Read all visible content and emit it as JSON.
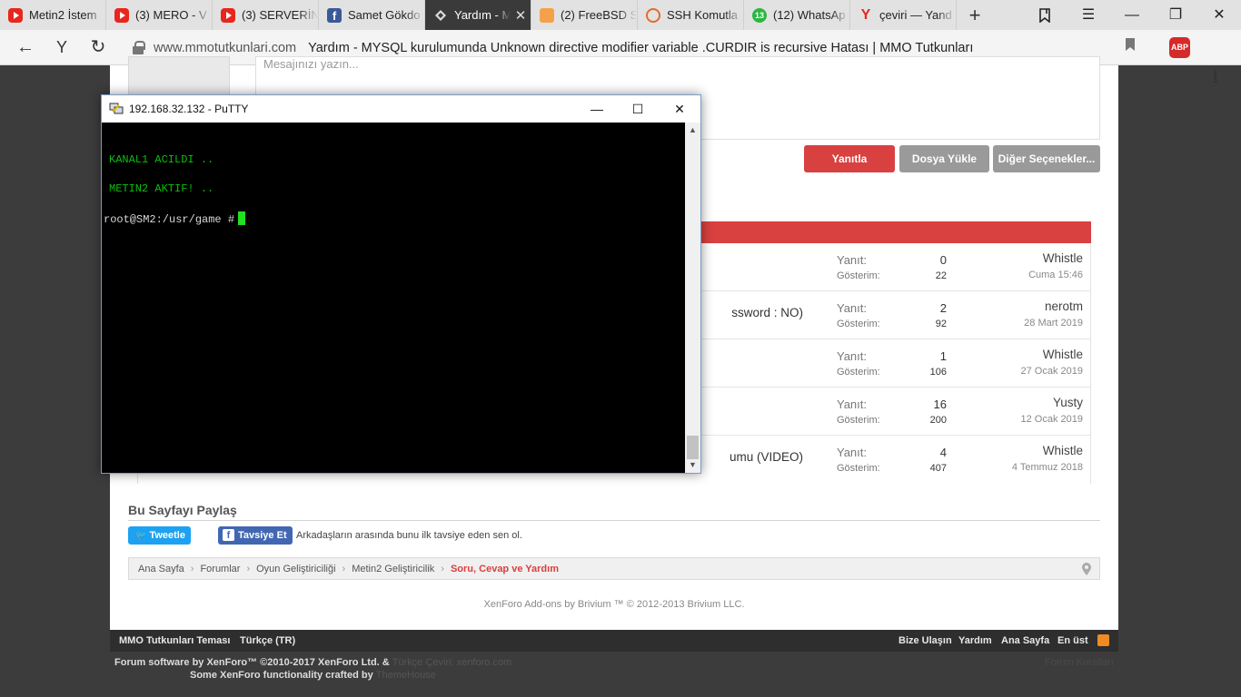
{
  "tabs": [
    {
      "label": "Metin2 İstem",
      "icon": "youtube-icon"
    },
    {
      "label": "(3) MERO - V",
      "icon": "youtube-icon"
    },
    {
      "label": "(3) SERVERİN",
      "icon": "youtube-icon"
    },
    {
      "label": "Samet Gökdo",
      "icon": "facebook-icon"
    },
    {
      "label": "Yardım - M",
      "icon": "xenforo-icon",
      "active": true
    },
    {
      "label": "(2) FreeBSD S",
      "icon": "freebsd-icon"
    },
    {
      "label": "SSH Komutla",
      "icon": "ssh-icon"
    },
    {
      "label": "(12) WhatsAp",
      "icon": "whatsapp-icon",
      "badge": "13"
    },
    {
      "label": "çeviri — Yand",
      "icon": "yandex-icon"
    }
  ],
  "address": {
    "domain": "www.mmotutkunlari.com",
    "title": "Yardım - MYSQL kurulumunda Unknown directive modifier variable .CURDIR is recursive Hatası | MMO Tutkunları"
  },
  "abp_label": "ABP",
  "editor": {
    "placeholder": "Mesajınızı yazın..."
  },
  "buttons": {
    "reply": "Yanıtla",
    "upload": "Dosya Yükle",
    "more": "Diğer Seçenekler..."
  },
  "threads": [
    {
      "title": "",
      "replies_label": "Yanıt:",
      "views_label": "Gösterim:",
      "replies": "0",
      "views": "22",
      "user": "Whistle",
      "date": "Cuma 15:46"
    },
    {
      "title": "ssword : NO)",
      "replies_label": "Yanıt:",
      "views_label": "Gösterim:",
      "replies": "2",
      "views": "92",
      "user": "nerotm",
      "date": "28 Mart 2019"
    },
    {
      "title": "",
      "replies_label": "Yanıt:",
      "views_label": "Gösterim:",
      "replies": "1",
      "views": "106",
      "user": "Whistle",
      "date": "27 Ocak 2019"
    },
    {
      "title": "",
      "replies_label": "Yanıt:",
      "views_label": "Gösterim:",
      "replies": "16",
      "views": "200",
      "user": "Yusty",
      "date": "12 Ocak 2019"
    },
    {
      "title": "umu (VIDEO)",
      "replies_label": "Yanıt:",
      "views_label": "Gösterim:",
      "replies": "4",
      "views": "407",
      "user": "Whistle",
      "date": "4 Temmuz 2018"
    }
  ],
  "share": {
    "title": "Bu Sayfayı Paylaş",
    "tweet": "Tweetle",
    "fb": "Tavsiye Et",
    "fb_text": "Arkadaşların arasında bunu ilk tavsiye eden sen ol."
  },
  "breadcrumb": [
    "Ana Sayfa",
    "Forumlar",
    "Oyun Geliştiriciliği",
    "Metin2 Geliştiricilik",
    "Soru, Cevap ve Yardım"
  ],
  "addons": "XenForo Add-ons by Brivium ™ © 2012-2013 Brivium LLC.",
  "footer": {
    "theme": "MMO Tutkunları Teması",
    "lang": "Türkçe (TR)",
    "contact": "Bize Ulaşın",
    "help": "Yardım",
    "home": "Ana Sayfa",
    "top": "En üst",
    "software": "Forum software by XenForo™ ©2010-2017 XenForo Ltd. &",
    "software_dim": "Türkçe Çeviri: xenforo.com",
    "crafted": "Some XenForo functionality crafted by",
    "crafted_dim": "ThemeHouse",
    "rules": "Forum Kuralları"
  },
  "putty": {
    "title": "192.168.32.132 - PuTTY",
    "lines": [
      {
        "text": "KANAL1 ACILDI ..",
        "color": "green"
      },
      {
        "text": "METIN2 AKTIF! ..",
        "color": "green"
      },
      {
        "text": "root@SM2:/usr/game #",
        "color": "white"
      }
    ]
  },
  "colors": {
    "accent_red": "#d94040",
    "term_green": "#0bbf0b",
    "twitter": "#1da1f2",
    "facebook": "#4267b2"
  }
}
